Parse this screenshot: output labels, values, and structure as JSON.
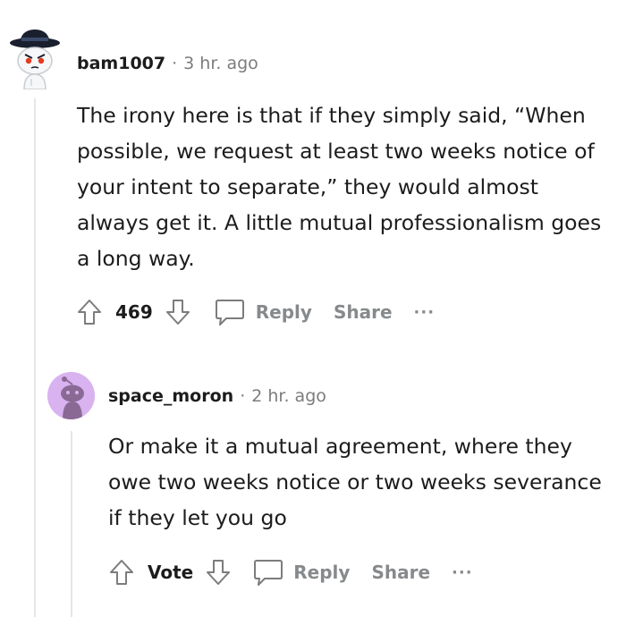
{
  "comments": [
    {
      "username": "bam1007",
      "separator": "·",
      "time": "3 hr. ago",
      "body": "The irony here is that if they simply said, “When possible, we request at least two weeks notice of your intent to separate,” they would almost always get it. A little mutual professionalism goes a long way.",
      "vote_label": "469",
      "reply_label": "Reply",
      "share_label": "Share",
      "more_label": "···"
    },
    {
      "username": "space_moron",
      "separator": "·",
      "time": "2 hr. ago",
      "body": "Or make it a mutual agreement, where they owe two weeks notice or two weeks severance if they let you go",
      "vote_label": "Vote",
      "reply_label": "Reply",
      "share_label": "Share",
      "more_label": "···"
    }
  ],
  "colors": {
    "text": "#1c1c1c",
    "muted": "#878a8c",
    "thread_line": "#e4e6e8",
    "avatar2_bg": "#d9b3f0"
  },
  "icons": [
    "snoo-hat-avatar",
    "snoo-avatar",
    "upvote-arrow-icon",
    "downvote-arrow-icon",
    "comment-bubble-icon",
    "more-options-icon"
  ]
}
